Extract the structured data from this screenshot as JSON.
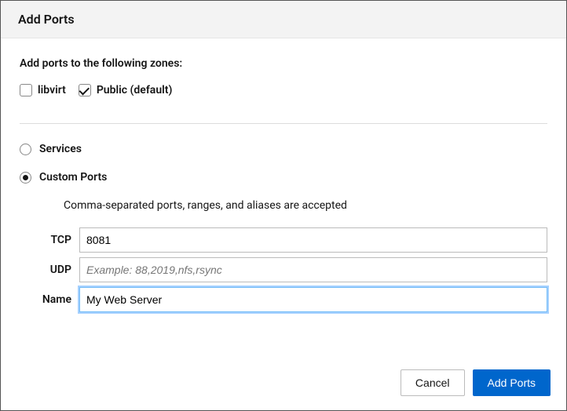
{
  "header": {
    "title": "Add Ports"
  },
  "zones": {
    "label": "Add ports to the following zones:",
    "items": [
      {
        "label": "libvirt",
        "checked": false
      },
      {
        "label": "Public (default)",
        "checked": true
      }
    ]
  },
  "mode": {
    "services_label": "Services",
    "custom_label": "Custom Ports",
    "selected": "custom"
  },
  "custom": {
    "help": "Comma-separated ports, ranges, and aliases are accepted",
    "tcp": {
      "label": "TCP",
      "value": "8081",
      "placeholder": ""
    },
    "udp": {
      "label": "UDP",
      "value": "",
      "placeholder": "Example: 88,2019,nfs,rsync"
    },
    "name": {
      "label": "Name",
      "value": "My Web Server",
      "placeholder": ""
    }
  },
  "footer": {
    "cancel": "Cancel",
    "submit": "Add Ports"
  }
}
